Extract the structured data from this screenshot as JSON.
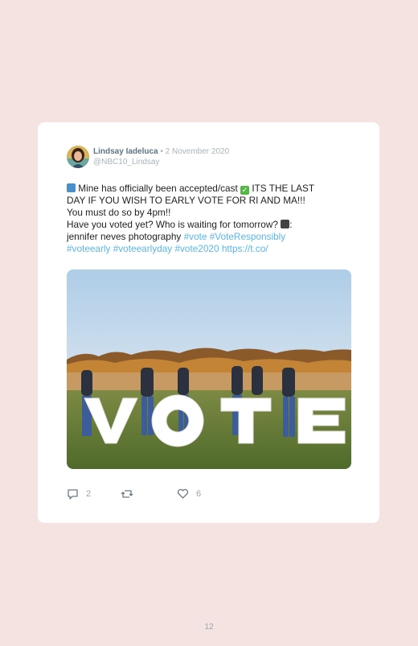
{
  "tweet": {
    "author_name": "Lindsay Iadeluca",
    "separator": "•",
    "date": "2 November 2020",
    "handle": "@NBC10_Lindsay",
    "text_line1": "Mine has officially been accepted/cast",
    "text_line1_tail": "ITS THE LAST",
    "text_line2": "DAY IF YOU WISH TO EARLY VOTE FOR RI AND MA!!!",
    "text_line3": "You must do so by 4pm!!",
    "text_line4": "Have you voted yet? Who is waiting for tomorrow?",
    "text_line4_tail": ":",
    "text_line5": "jennifer neves photography",
    "hashtag_vote": "#vote",
    "hashtag_voteresponsibly": "#VoteResponsibly",
    "hashtag_voteearly": "#voteearly",
    "hashtag_voteearlyday": "#voteearlyday",
    "hashtag_vote2020": "#vote2020",
    "link": "https://t.co/",
    "photo_letters": [
      "V",
      "O",
      "T",
      "E"
    ],
    "replies": "2",
    "likes": "6"
  },
  "icons": {
    "ballot": "ballot-box-icon",
    "check": "check-mark-button-icon",
    "camera": "camera-icon",
    "reply": "reply-icon",
    "retweet": "retweet-icon",
    "like": "heart-icon"
  },
  "colors": {
    "background": "#f5e3e2",
    "card": "#ffffff",
    "link": "#58b7ea",
    "author": "#5b7484",
    "muted": "#a9b4bb"
  },
  "page_number": "12"
}
